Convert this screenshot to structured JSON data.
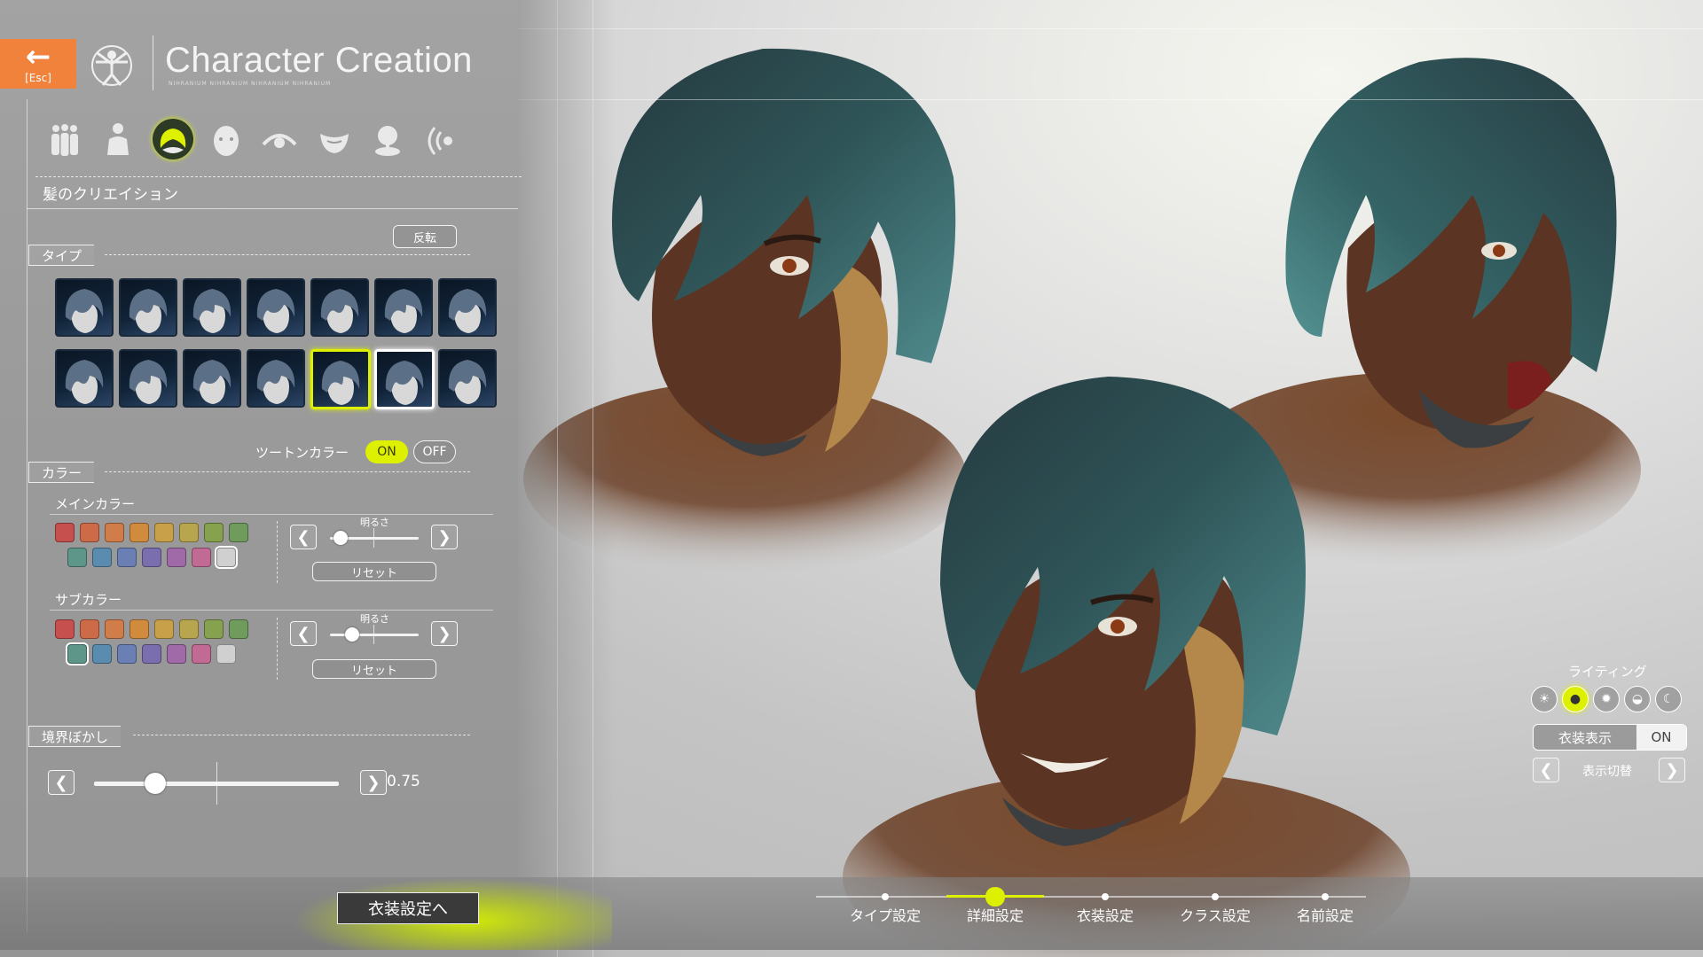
{
  "header": {
    "back_label": "[Esc]",
    "title": "Character Creation",
    "subtitle": "NIHRANIUM NIHRANIUM NIHRANIUM NIHRANIUM"
  },
  "categories": [
    {
      "name": "body-types"
    },
    {
      "name": "body"
    },
    {
      "name": "hair",
      "active": true
    },
    {
      "name": "face"
    },
    {
      "name": "eye"
    },
    {
      "name": "mouth"
    },
    {
      "name": "makeup"
    },
    {
      "name": "voice"
    }
  ],
  "section_title": "髪のクリエイション",
  "flip_label": "反転",
  "type_section": {
    "label": "タイプ",
    "rows": 2,
    "per_row": 7,
    "selected_index": 11,
    "hover_index": 12
  },
  "two_tone": {
    "label": "ツートンカラー",
    "on_label": "ON",
    "off_label": "OFF",
    "value": "ON"
  },
  "color_section": {
    "label": "カラー",
    "main": {
      "label": "メインカラー",
      "brightness_label": "明るさ",
      "brightness": 0.12,
      "reset_label": "リセット",
      "row1": [
        "#c5504e",
        "#cd6a47",
        "#d07d4a",
        "#d18b3c",
        "#c9a04a",
        "#b8a64e",
        "#86a24e",
        "#6f9b5c"
      ],
      "row2": [
        "#5f968a",
        "#5a8cb0",
        "#6a80b5",
        "#7b6eae",
        "#a06aa8",
        "#c06a94",
        "#d0d0d0"
      ],
      "selected": "row2-6"
    },
    "sub": {
      "label": "サブカラー",
      "brightness_label": "明るさ",
      "brightness": 0.25,
      "reset_label": "リセット",
      "row1": [
        "#c5504e",
        "#cd6a47",
        "#d07d4a",
        "#d18b3c",
        "#c9a04a",
        "#b8a64e",
        "#86a24e",
        "#6f9b5c"
      ],
      "row2": [
        "#5f968a",
        "#5a8cb0",
        "#6a80b5",
        "#7b6eae",
        "#a06aa8",
        "#c06a94",
        "#d0d0d0"
      ],
      "selected": "row2-0"
    }
  },
  "blur_section": {
    "label": "境界ぼかし",
    "value": 0.75,
    "value_text": "0.75"
  },
  "next_button": "衣装設定へ",
  "steps": [
    "タイプ設定",
    "詳細設定",
    "衣装設定",
    "クラス設定",
    "名前設定"
  ],
  "active_step": 1,
  "lighting": {
    "label": "ライティング",
    "modes": [
      "sunrise",
      "day",
      "bright",
      "sunset",
      "night"
    ],
    "active_index": 1
  },
  "costume_display": {
    "label": "衣装表示",
    "value": "ON"
  },
  "view_switch_label": "表示切替",
  "colors": {
    "accent": "#dcf000",
    "esc": "#f0823c",
    "hair": "#2e4f52",
    "skin": "#5a3424"
  }
}
